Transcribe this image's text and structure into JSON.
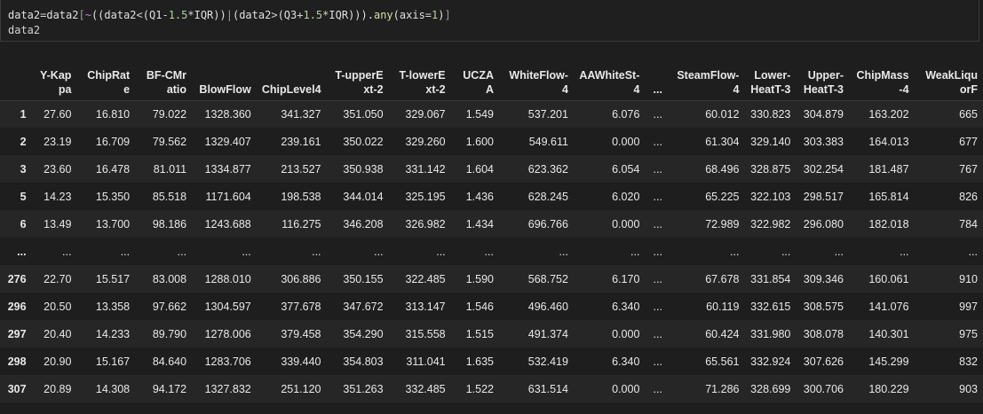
{
  "code": {
    "line1_tokens": [
      {
        "t": "data2",
        "c": "tk-var"
      },
      {
        "t": "=",
        "c": "tk-op"
      },
      {
        "t": "data2",
        "c": "tk-var"
      },
      {
        "t": "[",
        "c": "tk-brk"
      },
      {
        "t": "~",
        "c": "tk-tilde"
      },
      {
        "t": "((data2",
        "c": "tk-var"
      },
      {
        "t": "<",
        "c": "tk-op"
      },
      {
        "t": "(Q1",
        "c": "tk-var"
      },
      {
        "t": "-",
        "c": "tk-op"
      },
      {
        "t": "1.5",
        "c": "tk-num"
      },
      {
        "t": "*",
        "c": "tk-op"
      },
      {
        "t": "IQR))",
        "c": "tk-var"
      },
      {
        "t": "|",
        "c": "tk-pipe"
      },
      {
        "t": "(data2",
        "c": "tk-var"
      },
      {
        "t": ">",
        "c": "tk-op"
      },
      {
        "t": "(Q3",
        "c": "tk-var"
      },
      {
        "t": "+",
        "c": "tk-op"
      },
      {
        "t": "1.5",
        "c": "tk-num"
      },
      {
        "t": "*",
        "c": "tk-op"
      },
      {
        "t": "IQR))).",
        "c": "tk-var"
      },
      {
        "t": "any",
        "c": "tk-fn"
      },
      {
        "t": "(axis",
        "c": "tk-var"
      },
      {
        "t": "=",
        "c": "tk-op"
      },
      {
        "t": "1",
        "c": "tk-num"
      },
      {
        "t": ")",
        "c": "tk-var"
      },
      {
        "t": "]",
        "c": "tk-brk"
      }
    ],
    "line2": "data2"
  },
  "table": {
    "columns": [
      "",
      "Y-Kappa",
      "ChipRate",
      "BF-CMratio",
      "BlowFlow",
      "ChipLevel4",
      "T-upperExt-2",
      "T-lowerExt-2",
      "UCZAA",
      "WhiteFlow-4",
      "AAWhiteSt-4",
      "...",
      "SteamFlow-4",
      "Lower-HeatT-3",
      "Upper-HeatT-3",
      "ChipMass-4",
      "WeakLiquorF"
    ],
    "rows": [
      [
        "1",
        "27.60",
        "16.810",
        "79.022",
        "1328.360",
        "341.327",
        "351.050",
        "329.067",
        "1.549",
        "537.201",
        "6.076",
        "...",
        "60.012",
        "330.823",
        "304.879",
        "163.202",
        "665"
      ],
      [
        "2",
        "23.19",
        "16.709",
        "79.562",
        "1329.407",
        "239.161",
        "350.022",
        "329.260",
        "1.600",
        "549.611",
        "0.000",
        "...",
        "61.304",
        "329.140",
        "303.383",
        "164.013",
        "677"
      ],
      [
        "3",
        "23.60",
        "16.478",
        "81.011",
        "1334.877",
        "213.527",
        "350.938",
        "331.142",
        "1.604",
        "623.362",
        "6.054",
        "...",
        "68.496",
        "328.875",
        "302.254",
        "181.487",
        "767"
      ],
      [
        "5",
        "14.23",
        "15.350",
        "85.518",
        "1171.604",
        "198.538",
        "344.014",
        "325.195",
        "1.436",
        "628.245",
        "6.020",
        "...",
        "65.225",
        "322.103",
        "298.517",
        "165.814",
        "826"
      ],
      [
        "6",
        "13.49",
        "13.700",
        "98.186",
        "1243.688",
        "116.275",
        "346.208",
        "326.982",
        "1.434",
        "696.766",
        "0.000",
        "...",
        "72.989",
        "322.982",
        "296.080",
        "182.018",
        "784"
      ],
      [
        "...",
        "...",
        "...",
        "...",
        "...",
        "...",
        "...",
        "...",
        "...",
        "...",
        "...",
        "...",
        "...",
        "...",
        "...",
        "...",
        "..."
      ],
      [
        "276",
        "22.70",
        "15.517",
        "83.008",
        "1288.010",
        "306.886",
        "350.155",
        "322.485",
        "1.590",
        "568.752",
        "6.170",
        "...",
        "67.678",
        "331.854",
        "309.346",
        "160.061",
        "910"
      ],
      [
        "296",
        "20.50",
        "13.358",
        "97.662",
        "1304.597",
        "377.678",
        "347.672",
        "313.147",
        "1.546",
        "496.460",
        "6.340",
        "...",
        "60.119",
        "332.615",
        "308.575",
        "141.076",
        "997"
      ],
      [
        "297",
        "20.40",
        "14.233",
        "89.790",
        "1278.006",
        "379.458",
        "354.290",
        "315.558",
        "1.515",
        "491.374",
        "0.000",
        "...",
        "60.424",
        "331.980",
        "308.078",
        "140.301",
        "975"
      ],
      [
        "298",
        "20.90",
        "15.167",
        "84.640",
        "1283.706",
        "339.440",
        "354.803",
        "311.041",
        "1.635",
        "532.419",
        "6.340",
        "...",
        "65.561",
        "332.924",
        "307.626",
        "145.299",
        "832"
      ],
      [
        "307",
        "20.89",
        "14.308",
        "94.172",
        "1327.832",
        "251.120",
        "351.263",
        "332.485",
        "1.522",
        "631.514",
        "0.000",
        "...",
        "71.286",
        "328.699",
        "300.706",
        "180.229",
        "903"
      ]
    ]
  }
}
